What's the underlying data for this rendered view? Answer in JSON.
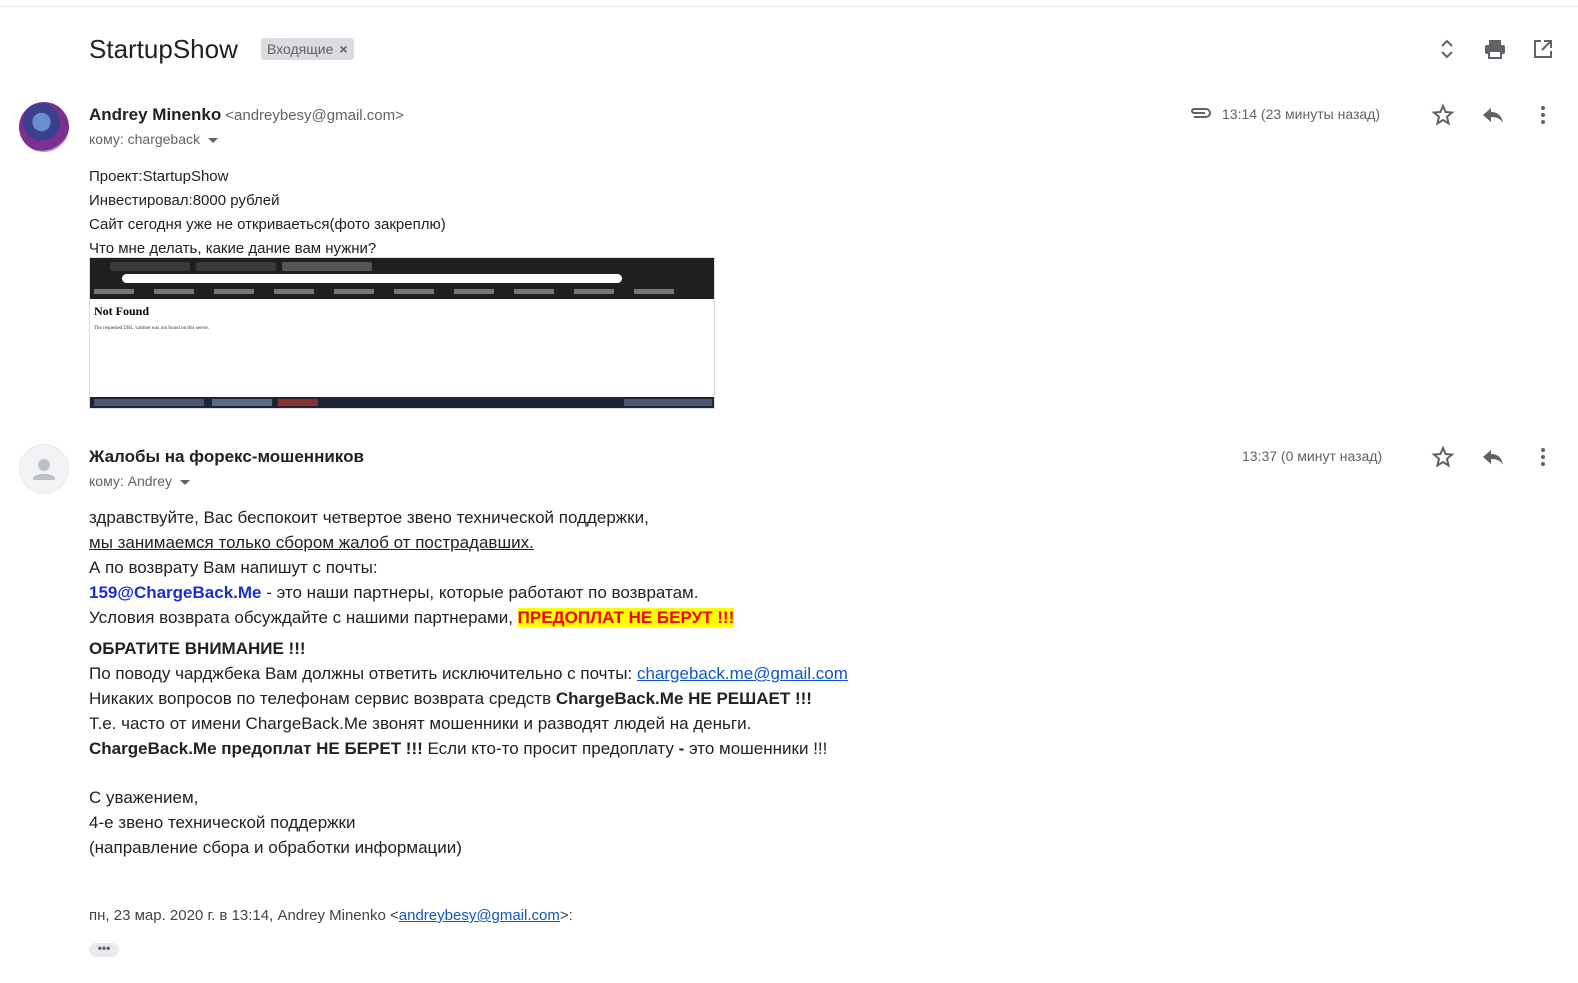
{
  "thread": {
    "subject": "StartupShow",
    "label": "Входящие",
    "label_remove": "×"
  },
  "message1": {
    "sender_name": "Andrey Minenko",
    "sender_email": "<andreybesy@gmail.com>",
    "recipient": "кому: chargeback",
    "time": "13:14 (23 минуты назад)",
    "lines": [
      "Проект:StartupShow",
      "Инвестировал:8000 рублей",
      "Сайт сегодня уже не откриваеться(фото закреплю)",
      "Что мне делать, какие дание вам нужни?"
    ],
    "screenshot": {
      "title": "Not Found",
      "text": "The requested URL /cabinet was not found on this server."
    }
  },
  "message2": {
    "sender_name": "Жалобы на форекс-мошенников",
    "recipient": "кому: Andrey",
    "time": "13:37 (0 минут назад)",
    "line1": "здравствуйте, Вас беспокоит четвертое звено технической поддержки,",
    "line2": "мы занимаемся только сбором жалоб от пострадавших.",
    "line3": "А по возврату Вам напишут с почты:",
    "line4_email": "159@ChargeBack.Me",
    "line4_rest": " - это наши партнеры, которые работают по возвратам.",
    "line5_text": "Условия возврата обсуждайте с нашими партнерами, ",
    "line5_highlight": "ПРЕДОПЛАТ НЕ БЕРУТ !!!",
    "attention": "ОБРАТИТЕ ВНИМАНИЕ !!!",
    "line6_text": "По поводу чарджбека Вам должны ответить исключительно с почты: ",
    "line6_link": "chargeback.me@gmail.com",
    "line7_text": "Никаких вопросов по телефонам сервис возврата средств ",
    "line7_bold": "ChargeBack.Me НЕ РЕШАЕТ !!!",
    "line8": "Т.е. часто от имени ChargeBack.Me звонят мошенники и разводят людей на деньги.",
    "line9_bold": "ChargeBack.Me предоплат НЕ БЕРЕТ !!!",
    "line9_text": " Если кто-то просит предоплату ",
    "line9_dash": "-",
    "line9_end": " это мошенники !!!",
    "sign1": "С уважением,",
    "sign2": "4-е звено технической поддержки",
    "sign3": "(направление сбора и обработки информации)",
    "quote_prefix": "пн, 23 мар. 2020 г. в 13:14, Andrey Minenko <",
    "quote_link": "andreybesy@gmail.com",
    "quote_suffix": ">:",
    "ellipsis": "•••"
  },
  "icons": [
    "expand-collapse-icon",
    "print-icon",
    "open-in-new-window-icon",
    "attachment-icon",
    "star-icon",
    "reply-icon",
    "more-vert-icon",
    "default-avatar-icon"
  ],
  "colors": {
    "link": "#1155cc",
    "highlight_bg": "#ffff00",
    "highlight_text": "#ff0000",
    "partner_email": "#1a2fd0"
  }
}
